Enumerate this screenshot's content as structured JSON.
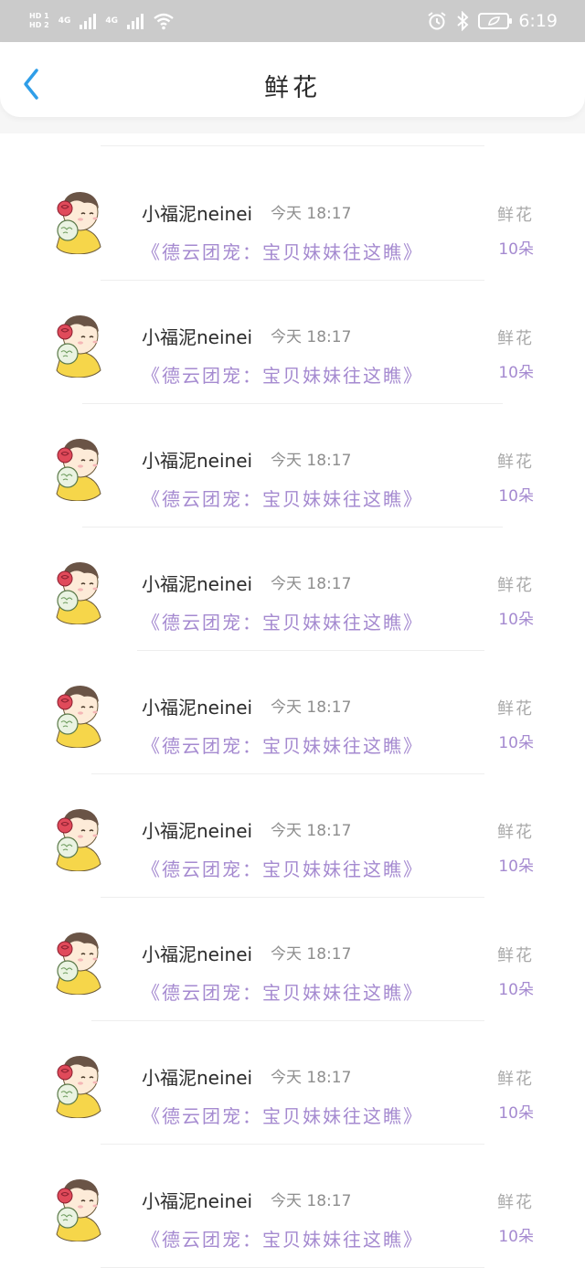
{
  "status_bar": {
    "hd1": "HD 1",
    "hd2": "HD 2",
    "net1": "4G",
    "net2": "4G",
    "time": "6:19",
    "icons": [
      "alarm-icon",
      "bluetooth-icon",
      "battery-icon"
    ]
  },
  "header": {
    "title": "鲜花",
    "back_icon": "chevron-left-icon"
  },
  "colors": {
    "link": "#a58ad0",
    "name": "#2b2b2b",
    "muted": "#a9a9a9",
    "accent": "#2f9ee8"
  },
  "items": [
    {
      "name": "小福泥neinei",
      "time": "今天 18:17",
      "link": "《德云团宠：宝贝妹妹往这瞧》",
      "gift": "鲜花",
      "count": "10朵"
    },
    {
      "name": "小福泥neinei",
      "time": "今天 18:17",
      "link": "《德云团宠：宝贝妹妹往这瞧》",
      "gift": "鲜花",
      "count": "10朵"
    },
    {
      "name": "小福泥neinei",
      "time": "今天 18:17",
      "link": "《德云团宠：宝贝妹妹往这瞧》",
      "gift": "鲜花",
      "count": "10朵"
    },
    {
      "name": "小福泥neinei",
      "time": "今天 18:17",
      "link": "《德云团宠：宝贝妹妹往这瞧》",
      "gift": "鲜花",
      "count": "10朵"
    },
    {
      "name": "小福泥neinei",
      "time": "今天 18:17",
      "link": "《德云团宠：宝贝妹妹往这瞧》",
      "gift": "鲜花",
      "count": "10朵"
    },
    {
      "name": "小福泥neinei",
      "time": "今天 18:17",
      "link": "《德云团宠：宝贝妹妹往这瞧》",
      "gift": "鲜花",
      "count": "10朵"
    },
    {
      "name": "小福泥neinei",
      "time": "今天 18:17",
      "link": "《德云团宠：宝贝妹妹往这瞧》",
      "gift": "鲜花",
      "count": "10朵"
    },
    {
      "name": "小福泥neinei",
      "time": "今天 18:17",
      "link": "《德云团宠：宝贝妹妹往这瞧》",
      "gift": "鲜花",
      "count": "10朵"
    },
    {
      "name": "小福泥neinei",
      "time": "今天 18:17",
      "link": "《德云团宠：宝贝妹妹往这瞧》",
      "gift": "鲜花",
      "count": "10朵"
    }
  ]
}
